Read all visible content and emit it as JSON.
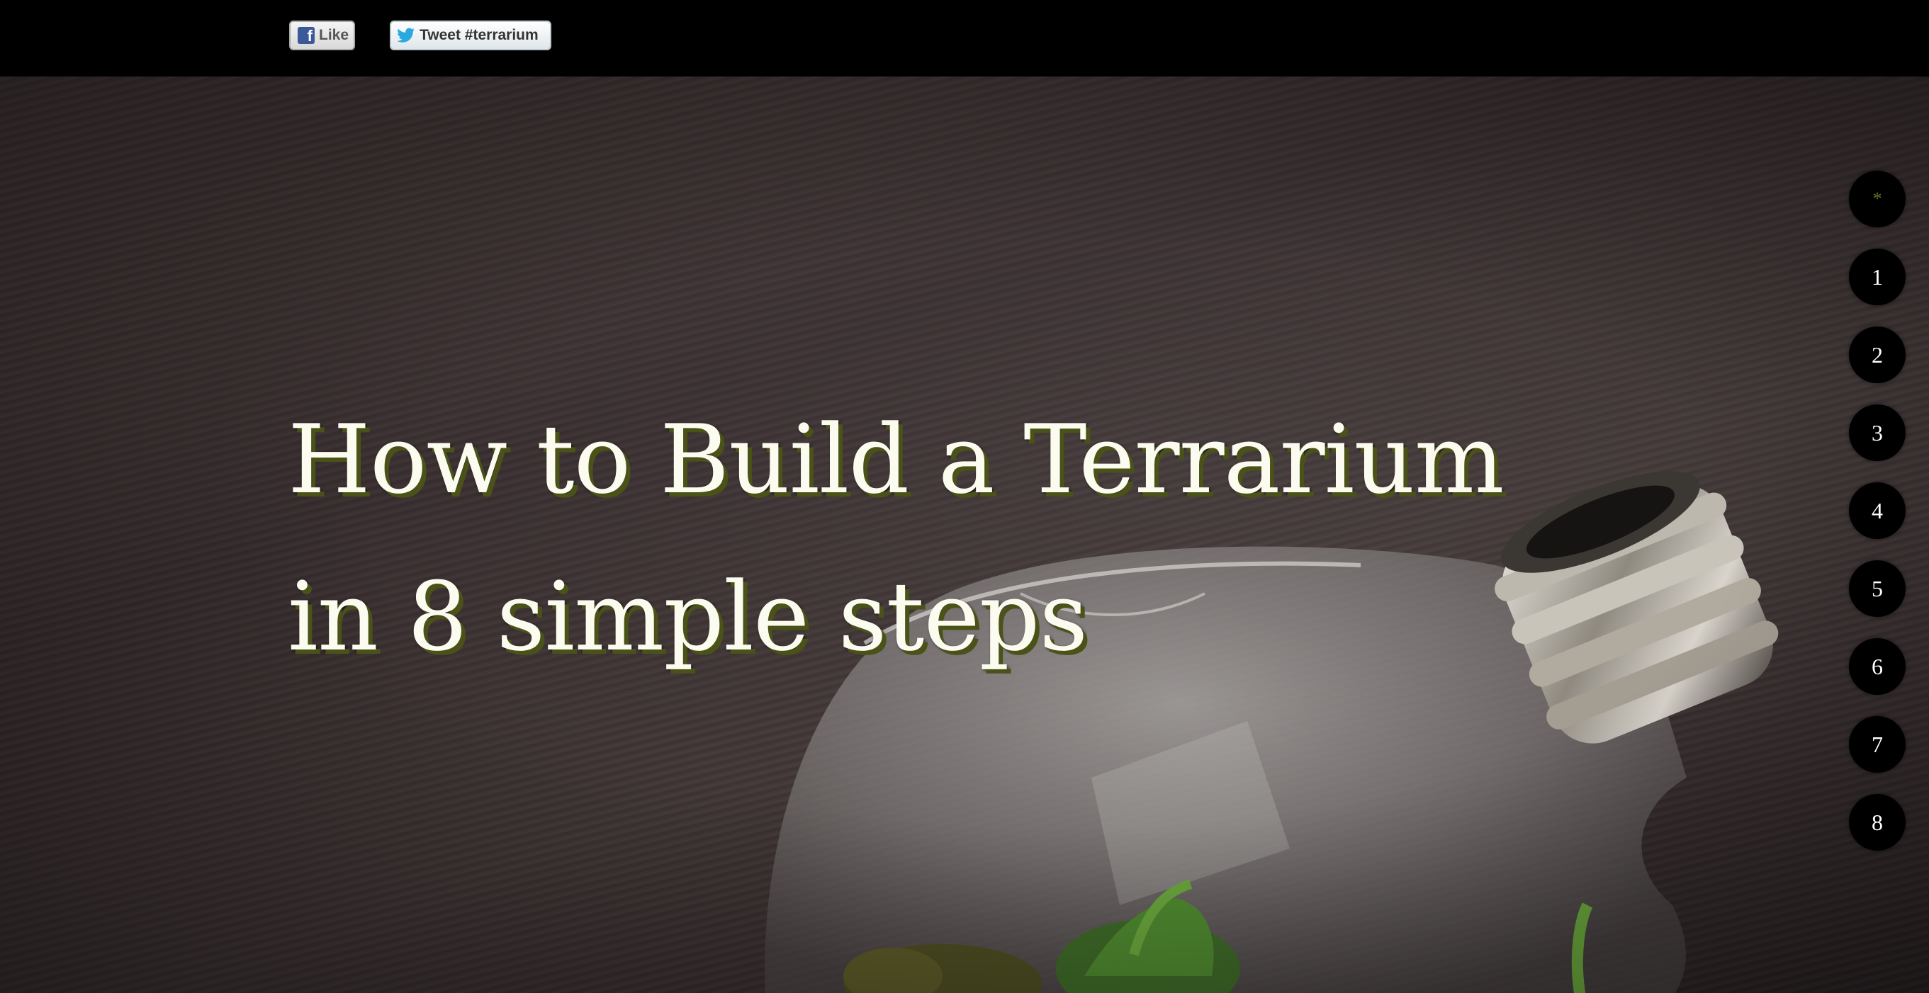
{
  "social": {
    "like_label": "Like",
    "tweet_label": "Tweet #terrarium"
  },
  "hero": {
    "title_line1": "How to Build a Terrarium",
    "title_line2": "in 8 simple steps"
  },
  "steps_nav": {
    "intro_label": "*",
    "steps": [
      "1",
      "2",
      "3",
      "4",
      "5",
      "6",
      "7",
      "8"
    ]
  },
  "colors": {
    "topbar": "#000000",
    "title_text": "#fbfbf0",
    "title_shadow": "#4a5218",
    "nav_dot": "#000000"
  }
}
